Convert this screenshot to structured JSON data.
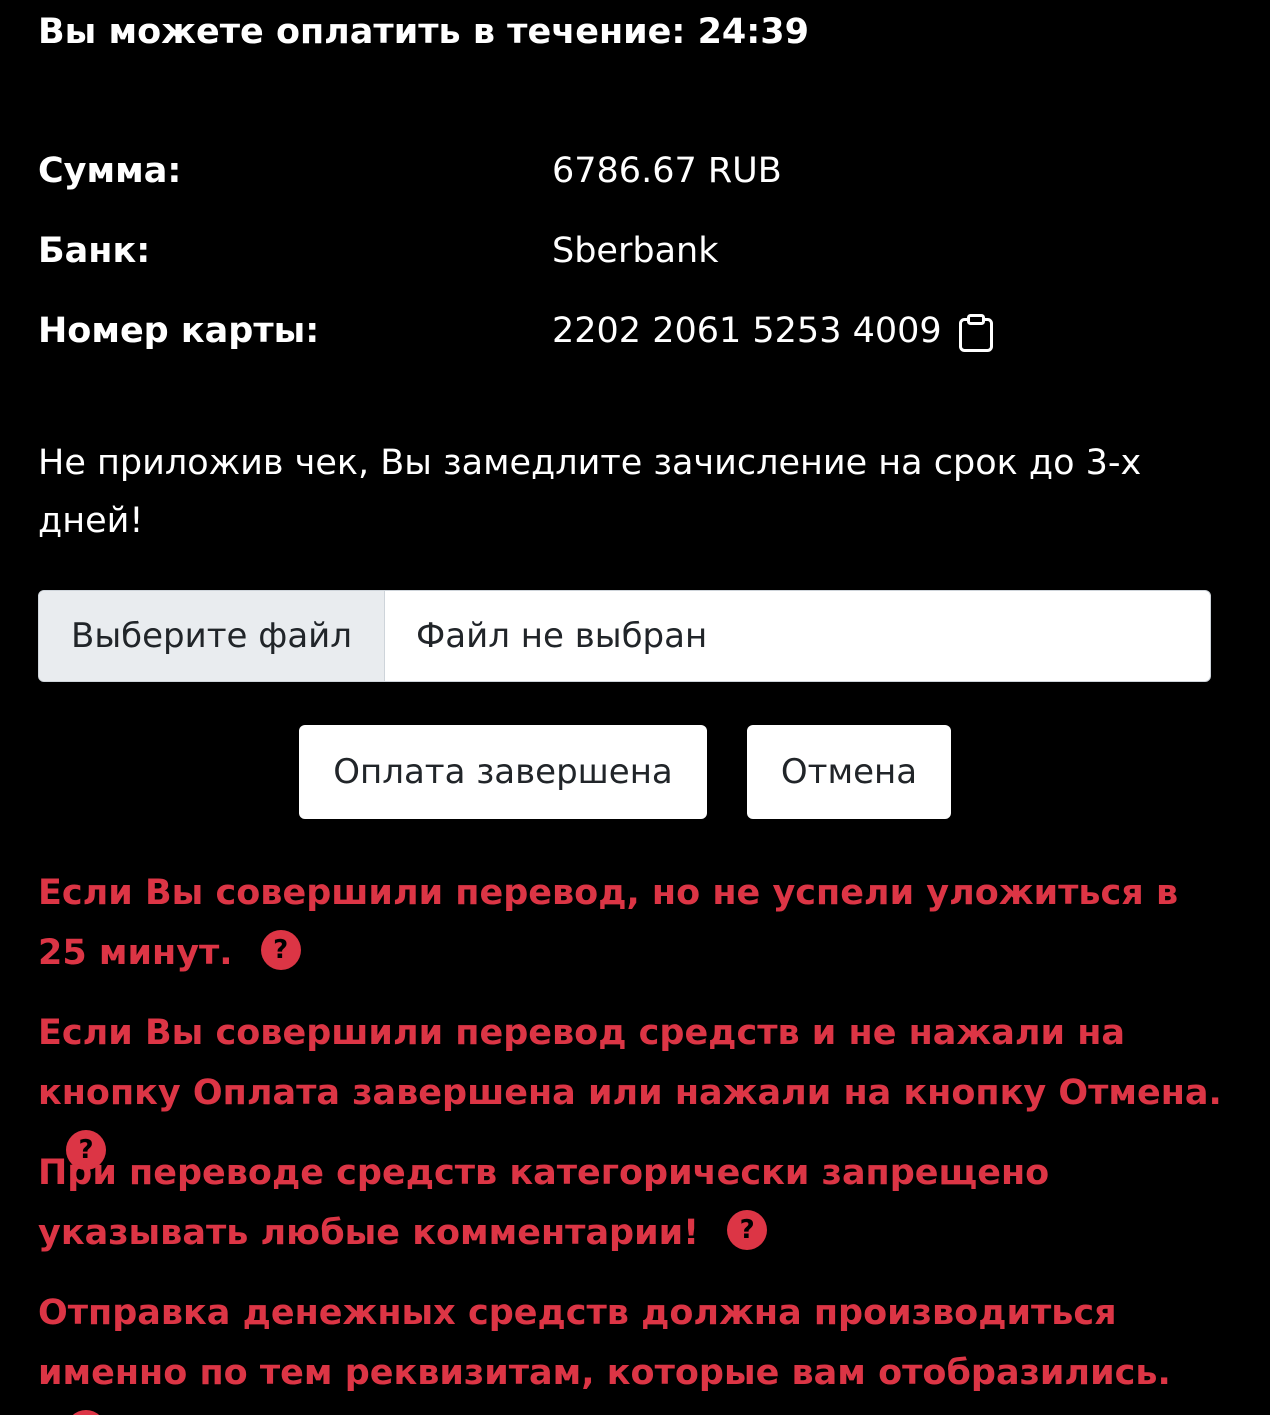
{
  "timer": {
    "label": "Вы можете оплатить в течение: 24:39"
  },
  "details": [
    {
      "label": "Сумма:",
      "value": "6786.67 RUB"
    },
    {
      "label": "Банк:",
      "value": "Sberbank"
    },
    {
      "label": "Номер карты:",
      "value": "2202 2061 5253 4009"
    }
  ],
  "icons": {
    "copy": "clipboard-icon",
    "help": "question-circle-icon"
  },
  "notice": "Не приложив чек, Вы замедлите зачисление на срок до 3-х дней!",
  "file_input": {
    "button_label": "Выберите файл",
    "status": "Файл не выбран"
  },
  "buttons": {
    "done": "Оплата завершена",
    "cancel": "Отмена"
  },
  "warnings": [
    "Если Вы совершили перевод, но не успели уложиться в 25 минут.",
    "Если Вы совершили перевод средств и не нажали на кнопку Оплата завершена или нажали на кнопку Отмена.",
    "При переводе средств категорически запрещено указывать любые комментарии!",
    "Отправка денежных средств должна производиться именно по тем реквизитам, которые вам отобразились."
  ],
  "help_glyph": "?",
  "colors": {
    "background": "#000000",
    "text": "#ffffff",
    "warning": "#dc3545",
    "input_border": "#ced4da",
    "file_button_bg": "#e9ecef"
  }
}
